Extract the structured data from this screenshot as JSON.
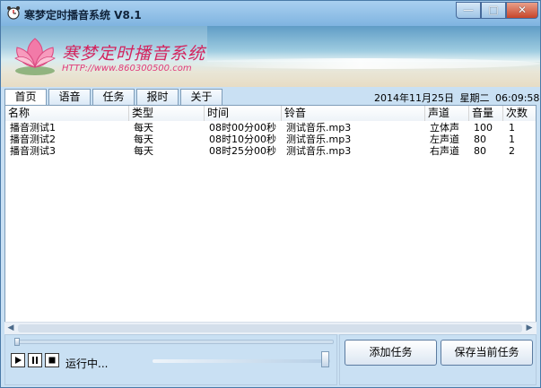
{
  "window": {
    "title": "寒梦定时播音系统 V8.1",
    "controls": {
      "minimize": "—",
      "maximize": "□",
      "close": "✕"
    }
  },
  "banner": {
    "title": "寒梦定时播音系统",
    "url": "HTTP://www.860300500.com"
  },
  "tabs": [
    {
      "label": "首页",
      "active": true
    },
    {
      "label": "语音",
      "active": false
    },
    {
      "label": "任务",
      "active": false
    },
    {
      "label": "报时",
      "active": false
    },
    {
      "label": "关于",
      "active": false
    }
  ],
  "datetime": {
    "date": "2014年11月25日",
    "weekday": "星期二",
    "time": "06:09:58"
  },
  "table": {
    "headers": [
      "名称",
      "类型",
      "时间",
      "铃音",
      "声道",
      "音量",
      "次数"
    ],
    "rows": [
      [
        "播音测试1",
        "每天",
        "08时00分00秒",
        "测试音乐.mp3",
        "立体声",
        "100",
        "1"
      ],
      [
        "播音测试2",
        "每天",
        "08时10分00秒",
        "测试音乐.mp3",
        "左声道",
        "80",
        "1"
      ],
      [
        "播音测试3",
        "每天",
        "08时25分00秒",
        "测试音乐.mp3",
        "右声道",
        "80",
        "2"
      ]
    ]
  },
  "player": {
    "play_icon": "play-icon",
    "pause_icon": "pause-icon",
    "stop_icon": "stop-icon",
    "status": "运行中..."
  },
  "actions": {
    "add_task": "添加任务",
    "save_task": "保存当前任务"
  },
  "colors": {
    "window_bg": "#c9e0f3",
    "banner_text": "#d3245e",
    "close_button": "#c7452a"
  }
}
